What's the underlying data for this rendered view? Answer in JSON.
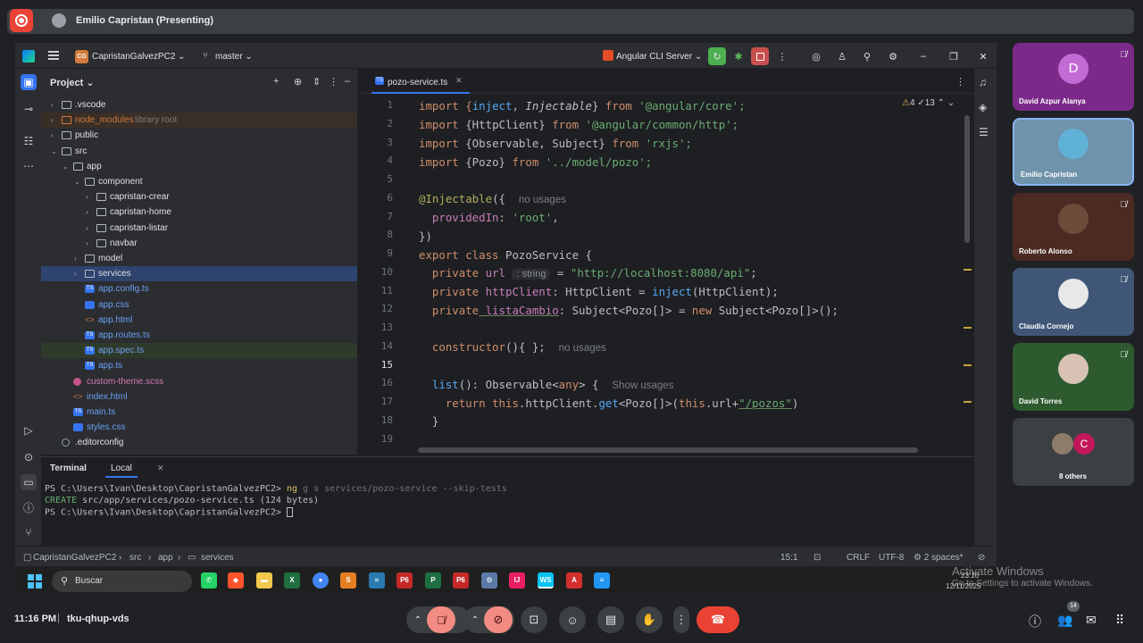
{
  "meet": {
    "presenter_label": "Emilio Capristan (Presenting)",
    "time": "11:16 PM",
    "separator": "|",
    "meeting_code": "tku-qhup-vds",
    "people_count": "14"
  },
  "ide": {
    "project_badge": "CG",
    "project_name": "CapristanGalvezPC2",
    "branch": "master",
    "run_config": "Angular CLI Server",
    "project_panel_title": "Project",
    "tree": [
      {
        "label": ".vscode",
        "type": "folder",
        "depth": 1,
        "arrow": "›"
      },
      {
        "label": "node_modules",
        "suffix": "library root",
        "type": "folder-excluded",
        "depth": 1,
        "arrow": "›"
      },
      {
        "label": "public",
        "type": "folder",
        "depth": 1,
        "arrow": "›"
      },
      {
        "label": "src",
        "type": "folder",
        "depth": 1,
        "arrow": "⌄"
      },
      {
        "label": "app",
        "type": "folder",
        "depth": 2,
        "arrow": "⌄"
      },
      {
        "label": "component",
        "type": "folder",
        "depth": 3,
        "arrow": "⌄"
      },
      {
        "label": "capristan-crear",
        "type": "folder",
        "depth": 4,
        "arrow": "›"
      },
      {
        "label": "capristan-home",
        "type": "folder",
        "depth": 4,
        "arrow": "›"
      },
      {
        "label": "capristan-listar",
        "type": "folder",
        "depth": 4,
        "arrow": "›"
      },
      {
        "label": "navbar",
        "type": "folder",
        "depth": 4,
        "arrow": "›"
      },
      {
        "label": "model",
        "type": "folder",
        "depth": 3,
        "arrow": "›"
      },
      {
        "label": "services",
        "type": "folder",
        "depth": 3,
        "arrow": "›",
        "selected": true
      },
      {
        "label": "app.config.ts",
        "type": "ts",
        "depth": 3
      },
      {
        "label": "app.css",
        "type": "css",
        "depth": 3
      },
      {
        "label": "app.html",
        "type": "html",
        "depth": 3
      },
      {
        "label": "app.routes.ts",
        "type": "ts",
        "depth": 3
      },
      {
        "label": "app.spec.ts",
        "type": "ts",
        "depth": 3,
        "spec": true
      },
      {
        "label": "app.ts",
        "type": "ts",
        "depth": 3
      },
      {
        "label": "custom-theme.scss",
        "type": "scss",
        "depth": 2
      },
      {
        "label": "index.html",
        "type": "html",
        "depth": 2
      },
      {
        "label": "main.ts",
        "type": "ts",
        "depth": 2
      },
      {
        "label": "styles.css",
        "type": "css",
        "depth": 2
      },
      {
        "label": ".editorconfig",
        "type": "cfg",
        "depth": 1
      }
    ],
    "editor_tab": "pozo-service.ts",
    "warnings": "4",
    "checks": "13",
    "line_numbers": [
      "1",
      "2",
      "3",
      "4",
      "5",
      "6",
      "7",
      "8",
      "9",
      "10",
      "11",
      "12",
      "13",
      "14",
      "15",
      "16",
      "17",
      "18",
      "19"
    ],
    "code": {
      "l1a": "import {",
      "l1b": "inject",
      "l1c": ", ",
      "l1d": "Injectable",
      "l1e": "} ",
      "l1f": "from",
      "l1g": " '@angular/core';",
      "l2a": "import",
      "l2b": " {HttpClient} ",
      "l2c": "from",
      "l2d": " '@angular/common/http';",
      "l3a": "import",
      "l3b": " {Observable, Subject} ",
      "l3c": "from",
      "l3d": " 'rxjs';",
      "l4a": "import",
      "l4b": " {Pozo} ",
      "l4c": "from",
      "l4d": " '../model/pozo';",
      "l6a": "@Injectable",
      "l6b": "({",
      "l6c": "no usages",
      "l7a": "providedIn",
      "l7b": ": ",
      "l7c": "'root'",
      "l7d": ",",
      "l8a": "})",
      "l9a": "export class",
      "l9b": " PozoService {",
      "l10a": "private",
      "l10b": " url",
      "l10c": ": string",
      "l10d": " = ",
      "l10e": "\"http://localhost:8080/api\"",
      "l10f": ";",
      "l11a": "private",
      "l11b": " httpClient",
      "l11c": ": HttpClient = ",
      "l11d": "inject",
      "l11e": "(HttpClient);",
      "l12a": "private",
      "l12b": " listaCambio",
      "l12c": ": Subject<Pozo[]> = ",
      "l12d": "new",
      "l12e": " Subject<Pozo[]>();",
      "l14a": "constructor",
      "l14b": "(){ };",
      "l14c": "no usages",
      "l16a": "list",
      "l16b": "(): Observable<",
      "l16c": "any",
      "l16d": "> {",
      "l16e": "Show usages",
      "l17a": "return",
      "l17b": " this",
      "l17c": ".httpClient.",
      "l17d": "get",
      "l17e": "<Pozo[]>(",
      "l17f": "this",
      "l17g": ".url+",
      "l17h": "\"/pozos\"",
      "l17i": ")",
      "l18a": "}"
    },
    "terminal": {
      "tab_title": "Terminal",
      "tab_local": "Local",
      "line1_prompt": "PS C:\\Users\\Ivan\\Desktop\\CapristanGalvezPC2> ",
      "line1_cmd": "ng",
      "line1_rest": " g s services/pozo-service ",
      "line1_flag": "--skip-tests",
      "line2_create": "CREATE",
      "line2_rest": " src/app/services/pozo-service.ts (124 bytes)",
      "line3_prompt": "PS C:\\Users\\Ivan\\Desktop\\CapristanGalvezPC2> "
    },
    "statusbar": {
      "crumb1": "CapristanGalvezPC2",
      "crumb2": "src",
      "crumb3": "app",
      "crumb4": "services",
      "position": "15:1",
      "line_sep": "CRLF",
      "encoding": "UTF-8",
      "indent": "2 spaces*"
    }
  },
  "taskbar": {
    "search_label": "Buscar",
    "clock_time": "23:16",
    "clock_date": "12/11/2025"
  },
  "activate": {
    "title": "Activate Windows",
    "subtitle": "Go to Settings to activate Windows."
  },
  "participants": [
    {
      "name": "David Azpur Alanya",
      "initial": "D",
      "muted": true,
      "color": "#7b2a8a",
      "avatar": "#c26bd4"
    },
    {
      "name": "Emilio Capristan",
      "initial": "",
      "muted": false,
      "color": "#6f93aa",
      "avatar": "#5fb2d6",
      "active": true
    },
    {
      "name": "Roberto Alonso",
      "initial": "",
      "muted": true,
      "color": "#4a2a22",
      "avatar": "#6b4b3a"
    },
    {
      "name": "Claudia Cornejo",
      "initial": "",
      "muted": true,
      "color": "#3f5677",
      "avatar": "#e8e8e8"
    },
    {
      "name": "David Torres",
      "initial": "",
      "muted": true,
      "color": "#2d5a2e",
      "avatar": "#d8c2b4"
    },
    {
      "name": "8 others",
      "initial": "C",
      "muted": false,
      "color": "#3c4043",
      "avatar": "#c2185b"
    }
  ],
  "colors": {
    "accent": "#3574f0",
    "hangup": "#ea4335",
    "record": "#ea4335"
  }
}
